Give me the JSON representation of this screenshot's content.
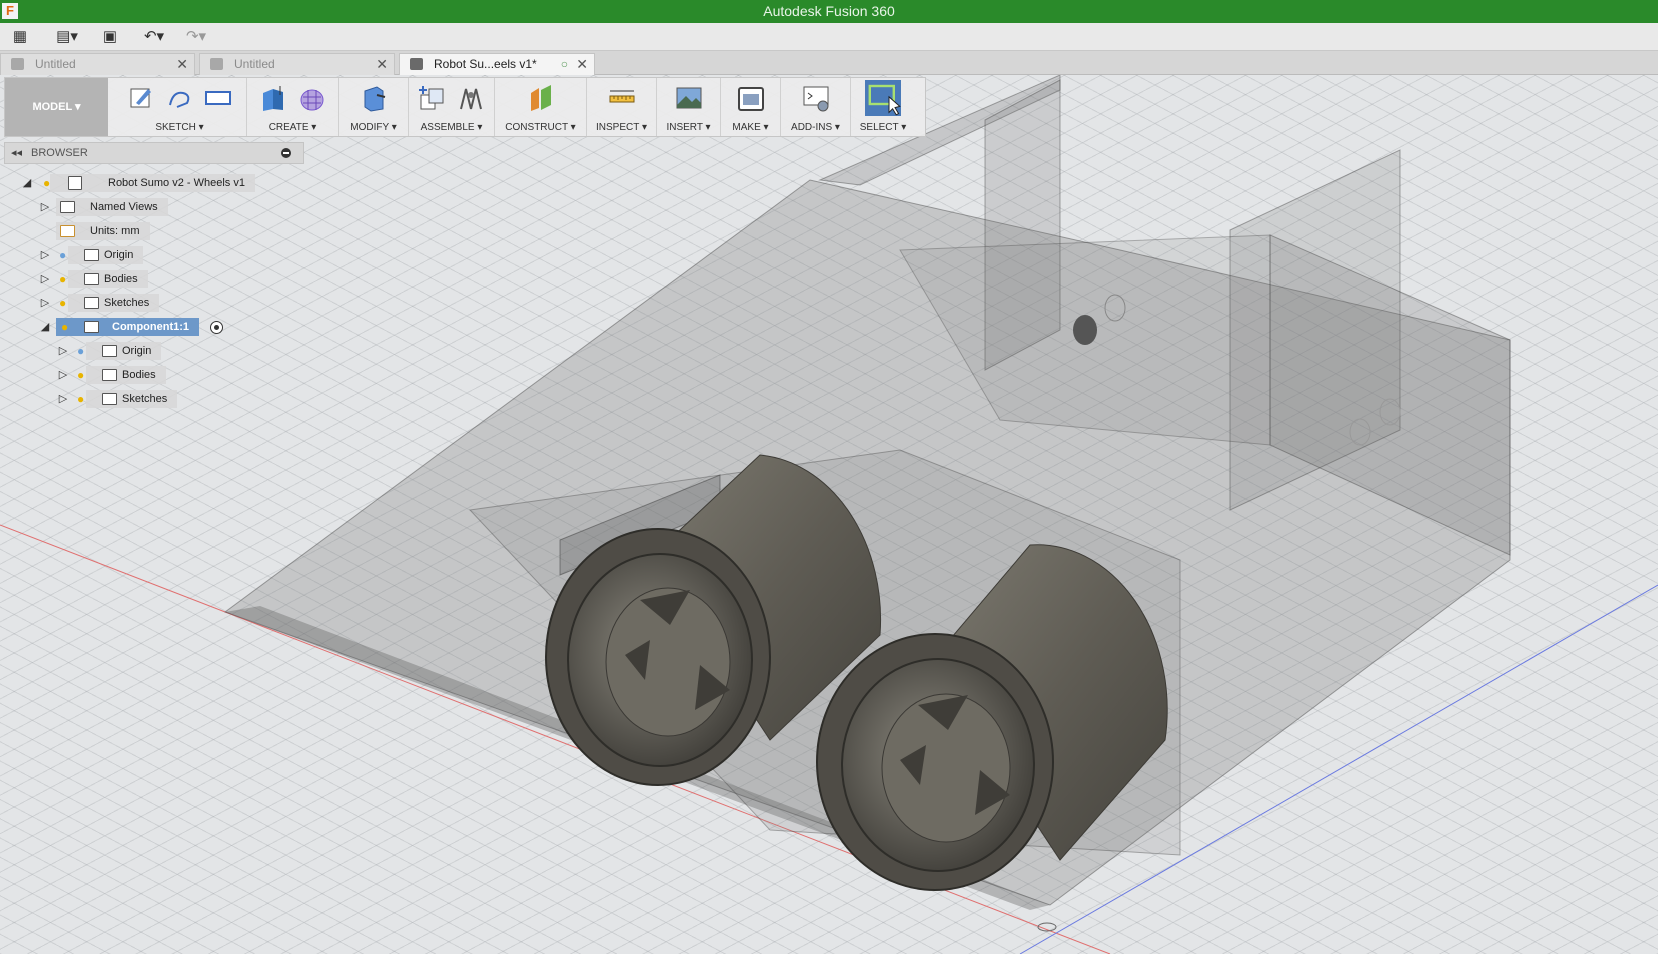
{
  "window": {
    "title": "Autodesk Fusion 360",
    "logo_letter": "F"
  },
  "quickbar": {
    "items": [
      {
        "name": "data-panel-icon",
        "glyph": "▦"
      },
      {
        "name": "file-menu-icon",
        "glyph": "▤▾"
      },
      {
        "name": "save-icon",
        "glyph": "▣"
      },
      {
        "name": "undo-icon",
        "glyph": "↶▾"
      },
      {
        "name": "redo-icon",
        "glyph": "↷▾"
      }
    ]
  },
  "tabs": [
    {
      "label": "Untitled",
      "active": false,
      "close": "✕"
    },
    {
      "label": "Untitled",
      "active": false,
      "close": "✕"
    },
    {
      "label": "Robot Su...eels v1*",
      "active": true,
      "close": "✕",
      "saved_indicator": "○"
    }
  ],
  "toolbar": {
    "mode_label": "MODEL ▾",
    "groups": [
      {
        "label": "SKETCH ▾",
        "icons": [
          "sketch-create-icon",
          "sketch-line-icon",
          "sketch-rectangle-icon"
        ]
      },
      {
        "label": "CREATE ▾",
        "icons": [
          "extrude-icon",
          "form-icon"
        ]
      },
      {
        "label": "MODIFY ▾",
        "icons": [
          "press-pull-icon"
        ]
      },
      {
        "label": "ASSEMBLE ▾",
        "icons": [
          "new-component-icon",
          "joint-icon"
        ]
      },
      {
        "label": "CONSTRUCT ▾",
        "icons": [
          "offset-plane-icon"
        ]
      },
      {
        "label": "INSPECT ▾",
        "icons": [
          "measure-icon"
        ]
      },
      {
        "label": "INSERT ▾",
        "icons": [
          "insert-image-icon"
        ]
      },
      {
        "label": "MAKE ▾",
        "icons": [
          "make-3d-print-icon"
        ]
      },
      {
        "label": "ADD-INS ▾",
        "icons": [
          "scripts-addins-icon"
        ]
      },
      {
        "label": "SELECT ▾",
        "icons": [
          "select-icon"
        ]
      }
    ]
  },
  "browser": {
    "title": "BROWSER",
    "collapse_glyph": "◂◂",
    "tree": [
      {
        "label": "Robot Sumo v2 - Wheels v1",
        "expander": "◢",
        "bulb": true,
        "folder": "document"
      },
      {
        "label": "Named Views",
        "expander": "▷",
        "bulb": false,
        "folder": "folder"
      },
      {
        "label": "Units: mm",
        "expander": "",
        "bulb": false,
        "folder": "units"
      },
      {
        "label": "Origin",
        "expander": "▷",
        "bulb": true,
        "bulb_off": true,
        "folder": "folder"
      },
      {
        "label": "Bodies",
        "expander": "▷",
        "bulb": true,
        "folder": "folder"
      },
      {
        "label": "Sketches",
        "expander": "▷",
        "bulb": true,
        "folder": "folder"
      },
      {
        "label": "Component1:1",
        "expander": "◢",
        "bulb": true,
        "folder": "component",
        "selected": true,
        "activate_radio": true
      },
      {
        "label": "Origin",
        "expander": "▷",
        "bulb": true,
        "bulb_off": true,
        "folder": "folder"
      },
      {
        "label": "Bodies",
        "expander": "▷",
        "bulb": true,
        "folder": "folder"
      },
      {
        "label": "Sketches",
        "expander": "▷",
        "bulb": true,
        "folder": "folder"
      }
    ]
  },
  "viewport": {
    "colors": {
      "x_axis": "#e05a5a",
      "z_axis": "#5a6ae0",
      "body": "#8a8a8a",
      "wheel": "#5d5a52"
    }
  }
}
